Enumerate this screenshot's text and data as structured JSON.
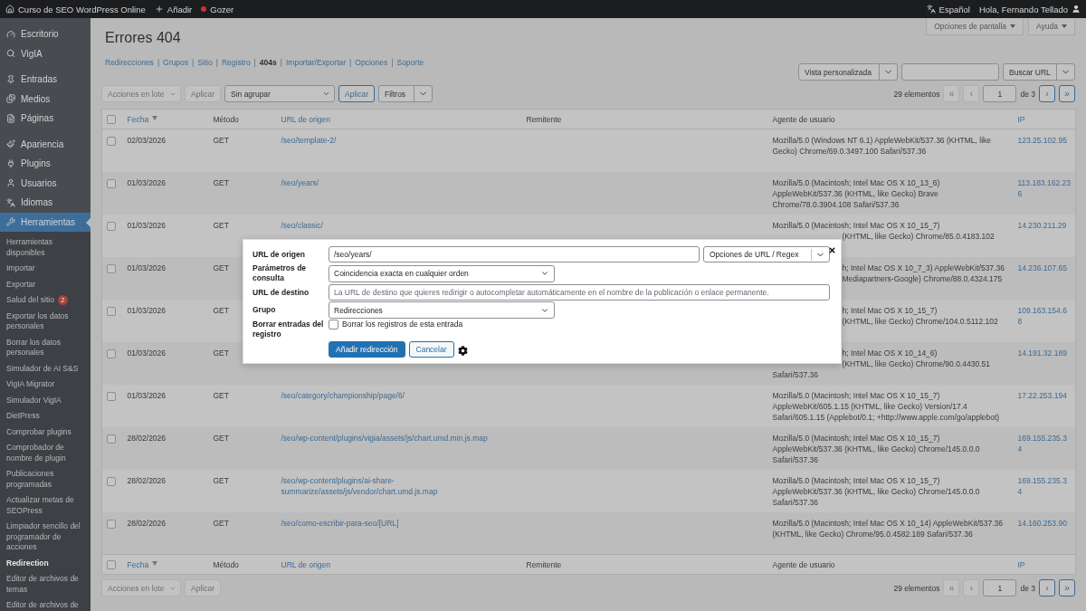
{
  "admin_bar": {
    "site": "Curso de SEO WordPress Online",
    "new": "Añadir",
    "plugin": "Gozer",
    "language": "Español",
    "greeting": "Hola, Fernando Tellado"
  },
  "sidebar": {
    "groups": [
      [
        {
          "label": "Escritorio",
          "selected": false
        },
        {
          "label": "VigIA",
          "selected": false
        }
      ],
      [
        {
          "label": "Entradas",
          "selected": false
        },
        {
          "label": "Medios",
          "selected": false
        },
        {
          "label": "Páginas",
          "selected": false
        }
      ],
      [
        {
          "label": "Apariencia",
          "selected": false
        },
        {
          "label": "Plugins",
          "selected": false
        },
        {
          "label": "Usuarios",
          "selected": false
        },
        {
          "label": "Idiomas",
          "selected": false
        },
        {
          "label": "Herramientas",
          "selected": true
        }
      ]
    ],
    "submenu": [
      {
        "label": "Herramientas disponibles",
        "selected": false
      },
      {
        "label": "Importar",
        "selected": false
      },
      {
        "label": "Exportar",
        "selected": false
      },
      {
        "label": "Salud del sitio",
        "selected": false,
        "badge": "2"
      },
      {
        "label": "Exportar los datos personales",
        "selected": false
      },
      {
        "label": "Borrar los datos personales",
        "selected": false
      },
      {
        "label": "Simulador de AI S&S",
        "selected": false
      },
      {
        "label": "VigIA Migrator",
        "selected": false
      },
      {
        "label": "Simulador VigIA",
        "selected": false
      },
      {
        "label": "DietPress",
        "selected": false
      },
      {
        "label": "Comprobar plugins",
        "selected": false
      },
      {
        "label": "Comprobador de nombre de plugin",
        "selected": false
      },
      {
        "label": "Publicaciones programadas",
        "selected": false
      },
      {
        "label": "Actualizar metas de SEOPress",
        "selected": false
      },
      {
        "label": "Limpiador sencillo del programador de acciones",
        "selected": false
      },
      {
        "label": "Redirection",
        "selected": true
      },
      {
        "label": "Editor de archivos de temas",
        "selected": false
      },
      {
        "label": "Editor de archivos de",
        "selected": false
      }
    ]
  },
  "screen_tabs": [
    "Opciones de pantalla",
    "Ayuda"
  ],
  "title": "Errores 404",
  "views": [
    {
      "label": "Redirecciones",
      "selected": false
    },
    {
      "separator_before": "|",
      "label": "Grupos",
      "selected": false
    },
    {
      "separator_before": "|",
      "label": "Sitio",
      "selected": false
    },
    {
      "separator_before": "|",
      "label": "Registro",
      "selected": false
    },
    {
      "separator_before": "|",
      "label": "404s",
      "selected": true
    },
    {
      "separator_before": "|",
      "label": "Importar/Exportar",
      "selected": false
    },
    {
      "separator_before": "|",
      "label": "Opciones",
      "selected": false
    },
    {
      "separator_before": "|",
      "label": "Soporte",
      "selected": false
    }
  ],
  "search": {
    "view_select": "Vista personalizada",
    "button": "Buscar URL"
  },
  "tablenav_top": {
    "bulk": "Acciones en lote",
    "bulk_apply": "Aplicar",
    "group": "Sin agrupar",
    "apply": "Aplicar",
    "filters": "Filtros",
    "count": "29 elementos",
    "page": "1",
    "of": "de 3",
    "pager": [
      {
        "label": "«",
        "disabled": true
      },
      {
        "label": "‹",
        "disabled": true
      },
      {
        "label": "›",
        "disabled": false
      },
      {
        "label": "»",
        "disabled": false
      }
    ]
  },
  "table": {
    "select_all_checked": false,
    "footer_select_all_checked": false,
    "columns": [
      {
        "label": "Fecha",
        "sortable": true,
        "sorted": true
      },
      {
        "label": "Método",
        "sortable": false,
        "sorted": false
      },
      {
        "label": "URL de origen",
        "sortable": true,
        "sorted": false
      },
      {
        "label": "Remitente",
        "sortable": false,
        "sorted": false
      },
      {
        "label": "Agente de usuario",
        "sortable": false,
        "sorted": false
      },
      {
        "label": "IP",
        "sortable": true,
        "sorted": false
      }
    ],
    "rows": [
      {
        "date": "02/03/2026",
        "method": "GET",
        "url": "/seo/template-2/",
        "agent": [
          {
            "text": "Mozilla/5.0 (Windows NT 6.1) AppleWebKit/537.36 (KHTML, like",
            "clipped": false
          },
          {
            "text": "Gecko) Chrome/69.0.3497.100 Safari/537.36",
            "clipped": false
          }
        ],
        "ip": "123.25.102.95",
        "checked": false
      },
      {
        "date": "01/03/2026",
        "method": "GET",
        "url": "/seo/years/",
        "agent": [
          {
            "text": "Mozilla/5.0 (Macintosh; Intel Mac OS X 10_13_6)",
            "clipped": false
          },
          {
            "text": "AppleWebKit/537.36 (KHTML, like Gecko) Brave",
            "clipped": false
          },
          {
            "text": "Chrome/78.0.3904.108 Safari/537.36",
            "clipped": false
          }
        ],
        "ip": "113.183.162.236",
        "checked": false
      },
      {
        "date": "01/03/2026",
        "method": "GET",
        "url": "/seo/classic/",
        "agent": [
          {
            "text": "Mozilla/5.0 (Macintosh; Intel Mac OS X 10_15_7)",
            "clipped": false
          },
          {
            "text": "(KHTML, like Gecko) Chrome/85.0.4183.102",
            "clipped": true
          }
        ],
        "ip": "14.230.211.29",
        "checked": false
      },
      {
        "date": "01/03/2026",
        "method": "GET",
        "agent": [
          {
            "text": "h; Intel Mac OS X 10_7_3) AppleWebKit/537.36",
            "clipped": true
          },
          {
            "text": "Mediapartners-Google) Chrome/88.0.4324.175",
            "clipped": true
          }
        ],
        "ip": "14.236.107.65",
        "checked": false
      },
      {
        "date": "01/03/2026",
        "method": "GET",
        "agent": [
          {
            "text": "h; Intel Mac OS X 10_15_7)",
            "clipped": true
          },
          {
            "text": "(KHTML, like Gecko) Chrome/104.0.5112.102",
            "clipped": true
          }
        ],
        "ip": "109.163.154.68",
        "checked": false
      },
      {
        "date": "01/03/2026",
        "method": "GET",
        "agent": [
          {
            "text": "h; Intel Mac OS X 10_14_6)",
            "clipped": true
          },
          {
            "text": "(KHTML, like Gecko) Chrome/90.0.4430.51",
            "clipped": true
          },
          {
            "text": "Safari/537.36",
            "clipped": false
          }
        ],
        "ip": "14.191.32.189",
        "checked": false
      },
      {
        "date": "01/03/2026",
        "method": "GET",
        "url": "/seo/category/championship/page/6/",
        "agent": [
          {
            "text": "Mozilla/5.0 (Macintosh; Intel Mac OS X 10_15_7)",
            "clipped": false
          },
          {
            "text": "AppleWebKit/605.1.15 (KHTML, like Gecko) Version/17.4",
            "clipped": false
          },
          {
            "text": "Safari/605.1.15 (Applebot/0.1; +http://www.apple.com/go/applebot)",
            "clipped": false
          }
        ],
        "ip": "17.22.253.194",
        "checked": false
      },
      {
        "date": "28/02/2026",
        "method": "GET",
        "url": "/seo/wp-content/plugins/vigia/assets/js/chart.umd.min.js.map",
        "agent": [
          {
            "text": "Mozilla/5.0 (Macintosh; Intel Mac OS X 10_15_7)",
            "clipped": false
          },
          {
            "text": "AppleWebKit/537.36 (KHTML, like Gecko) Chrome/145.0.0.0",
            "clipped": false
          },
          {
            "text": "Safari/537.36",
            "clipped": false
          }
        ],
        "ip": "169.155.235.34",
        "checked": false
      },
      {
        "date": "28/02/2026",
        "method": "GET",
        "url": "/seo/wp-content/plugins/ai-share-summarize/assets/js/vendor/chart.umd.js.map",
        "agent": [
          {
            "text": "Mozilla/5.0 (Macintosh; Intel Mac OS X 10_15_7)",
            "clipped": false
          },
          {
            "text": "AppleWebKit/537.36 (KHTML, like Gecko) Chrome/145.0.0.0",
            "clipped": false
          },
          {
            "text": "Safari/537.36",
            "clipped": false
          }
        ],
        "ip": "169.155.235.34",
        "checked": false
      },
      {
        "date": "28/02/2026",
        "method": "GET",
        "url": "/seo/como-escribir-para-seo/[URL]",
        "agent": [
          {
            "text": "Mozilla/5.0 (Macintosh; Intel Mac OS X 10_14) AppleWebKit/537.36",
            "clipped": false
          },
          {
            "text": "(KHTML, like Gecko) Chrome/95.0.4582.189 Safari/537.36",
            "clipped": false
          }
        ],
        "ip": "14.160.253.90",
        "checked": false
      }
    ],
    "footer_columns": [
      {
        "label": "Fecha",
        "sortable": true,
        "sorted": true
      },
      {
        "label": "Método",
        "sortable": false,
        "sorted": false
      },
      {
        "label": "URL de origen",
        "sortable": true,
        "sorted": false
      },
      {
        "label": "Remitente",
        "sortable": false,
        "sorted": false
      },
      {
        "label": "Agente de usuario",
        "sortable": false,
        "sorted": false
      },
      {
        "label": "IP",
        "sortable": true,
        "sorted": false
      }
    ]
  },
  "tablenav_bottom": {
    "bulk": "Acciones en lote",
    "bulk_apply": "Aplicar",
    "count": "29 elementos",
    "page": "1",
    "of": "de 3",
    "pager": [
      {
        "label": "«",
        "disabled": true
      },
      {
        "label": "‹",
        "disabled": true
      },
      {
        "label": "›",
        "disabled": false
      },
      {
        "label": "»",
        "disabled": false
      }
    ]
  },
  "modal": {
    "source_label": "URL de origen",
    "source_value": "/seo/years/",
    "url_options": "Opciones de URL / Regex",
    "query_label": "Parámetros de consulta",
    "query_value": "Coincidencia exacta en cualquier orden",
    "target_label": "URL de destino",
    "target_placeholder": "La URL de destino que quieres redirigir o autocompletar automáticamente en el nombre de la publicación o enlace permanente.",
    "group_label": "Grupo",
    "group_value": "Redirecciones",
    "log_label": "Borrar entradas del registro",
    "log_checkbox": {
      "label": "Borrar los registros de esta entrada",
      "checked": false
    },
    "submit": "Añadir redirección",
    "cancel": "Cancelar"
  }
}
